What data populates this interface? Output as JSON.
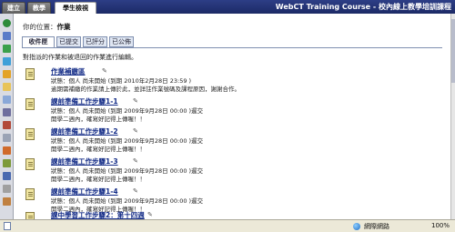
{
  "top_tabs": [
    {
      "label": "建立"
    },
    {
      "label": "教學"
    },
    {
      "label": "學生檢視"
    }
  ],
  "course_title": "WebCT Training Course - 校內線上教學培訓課程",
  "breadcrumb": {
    "prefix": "你的位置：",
    "current": "作業"
  },
  "sub_tabs": [
    {
      "label": "收件匣"
    },
    {
      "label": "已提交"
    },
    {
      "label": "已評分"
    },
    {
      "label": "已公佈"
    }
  ],
  "instructions": "對指派的作業和被退回的作業進行編輯。",
  "assignments": [
    {
      "title": "作業補繳區",
      "status": "狀態：個人 尚未開始 (到期 2010年2月28日 23:59 )",
      "note": "逾期需補繳的作業請上傳於此，並詳註作業號碼及課程原因，謝謝合作。"
    },
    {
      "title": "課前準備工作步驟1-1",
      "status": "狀態：個人 尚未開始 (到期 2009年9月28日 00:00 )遲交",
      "note": "開學二週內，確寫好記得上傳喔！！"
    },
    {
      "title": "課前準備工作步驟1-2",
      "status": "狀態：個人 尚未開始 (到期 2009年9月28日 00:00 )遲交",
      "note": "開學二週內，確寫好記得上傳喔！！"
    },
    {
      "title": "課前準備工作步驟1-3",
      "status": "狀態：個人 尚未開始 (到期 2009年9月28日 00:00 )遲交",
      "note": "開學二週內，確寫好記得上傳喔！！"
    },
    {
      "title": "課前準備工作步驟1-4",
      "status": "狀態：個人 尚未開始 (到期 2009年9月28日 00:00 )遲交",
      "note": "開學二週內，確寫好記得上傳喔！！"
    },
    {
      "title": "課中學習工作步驟2：第十四週",
      "status": "",
      "note": ""
    }
  ],
  "status_bar": {
    "zone": "網際網路",
    "zoom": "100%"
  },
  "colors": {
    "topbar": "#1c2a66",
    "link": "#112a86",
    "statusbar": "#ece9d8"
  }
}
